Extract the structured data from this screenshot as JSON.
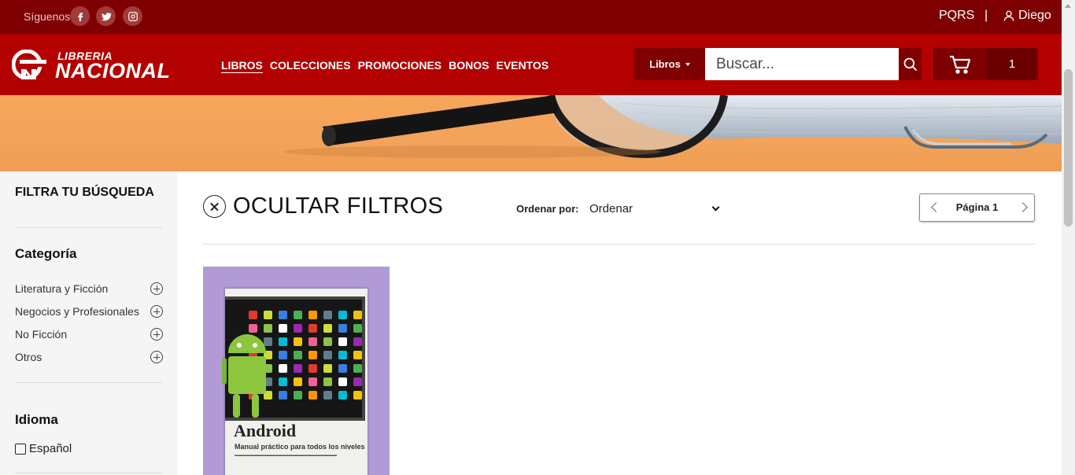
{
  "topbar": {
    "follow_label": "Síguenos",
    "social": [
      "facebook-icon",
      "twitter-icon",
      "instagram-icon"
    ],
    "pqrs": "PQRS",
    "separator": "|",
    "user_name": "Diego"
  },
  "header": {
    "logo_top": "LIBRERIA",
    "logo_bottom": "NACIONAL",
    "nav": [
      "LIBROS",
      "COLECCIONES",
      "PROMOCIONES",
      "BONOS",
      "EVENTOS"
    ],
    "active_nav": "LIBROS",
    "search_category": "Libros",
    "search_placeholder": "Buscar...",
    "cart_count": "1"
  },
  "sidebar": {
    "title": "FILTRA TU BÚSQUEDA",
    "category_heading": "Categoría",
    "categories": [
      "Literatura y Ficción",
      "Negocios y Profesionales",
      "No Ficción",
      "Otros"
    ],
    "language_heading": "Idioma",
    "languages": [
      "Español"
    ]
  },
  "main": {
    "hide_filters": "OCULTAR FILTROS",
    "sort_label": "Ordenar por:",
    "sort_value": "Ordenar",
    "page_label": "Página 1"
  },
  "product": {
    "cover_title": "Android",
    "cover_subtitle": "Manual práctico para todos los niveles"
  },
  "colors": {
    "topbar": "#7e0000",
    "header": "#b30000",
    "accent_dark": "#6a0000",
    "product_bg": "#b19ad6"
  }
}
